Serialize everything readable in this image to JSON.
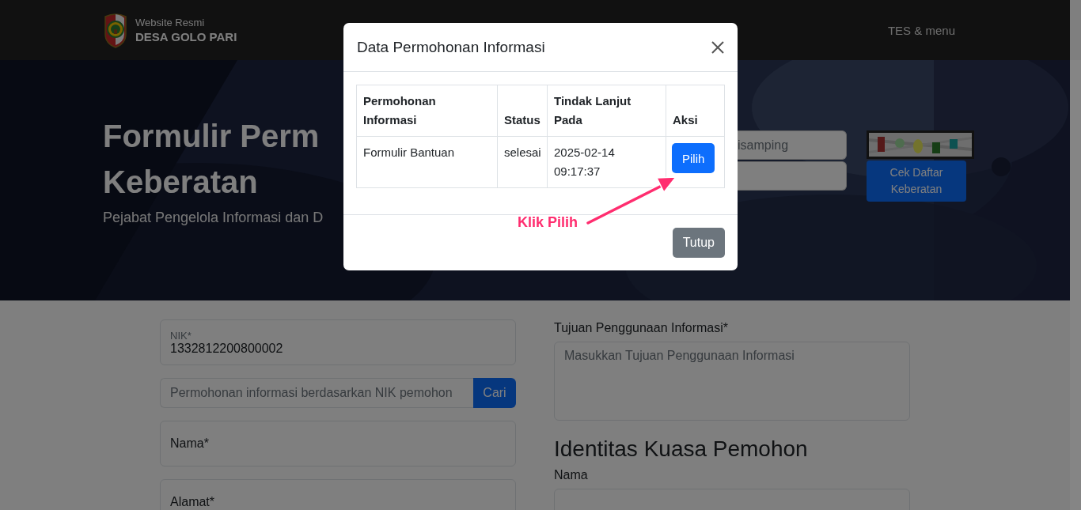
{
  "navbar": {
    "subtitle": "Website Resmi",
    "title": "DESA GOLO PARI",
    "menu": "TES & menu"
  },
  "hero": {
    "title_lines": [
      "Formulir Perm",
      "Keberatan"
    ],
    "subtitle": "Pejabat Pengelola Informasi dan D",
    "fields": [
      {
        "kind": "input",
        "placeholder": "isamping"
      },
      {
        "kind": "input"
      }
    ],
    "captcha": {
      "kind": "picture"
    },
    "button": "Cek Daftar Keberatan"
  },
  "form": {
    "left": [
      {
        "kind": "floating",
        "label": "NIK*",
        "value": "1332812200800002"
      },
      {
        "kind": "search",
        "placeholder": "Permohonan informasi berdasarkan NIK pemohon",
        "button": "Cari"
      },
      {
        "kind": "floating",
        "label": "Nama*"
      },
      {
        "kind": "floating",
        "label": "Alamat*"
      }
    ],
    "right": [
      {
        "kind": "textarea",
        "label": "Tujuan Penggunaan Informasi*",
        "placeholder": "Masukkan Tujuan Penggunaan Informasi"
      },
      {
        "kind": "heading",
        "text": "Identitas Kuasa Pemohon"
      },
      {
        "kind": "input",
        "label": "Nama"
      }
    ]
  },
  "modal": {
    "title": "Data Permohonan Informasi",
    "columns": [
      "Permohonan Informasi",
      "Status",
      "Tindak Lanjut Pada",
      "Aksi"
    ],
    "rows": [
      {
        "cells": [
          "Formulir Bantuan",
          "selesai",
          "2025-02-14 09:17:37"
        ],
        "action": "Pilih"
      }
    ],
    "close_button": "Tutup"
  },
  "annotation": {
    "text": "Klik Pilih"
  }
}
